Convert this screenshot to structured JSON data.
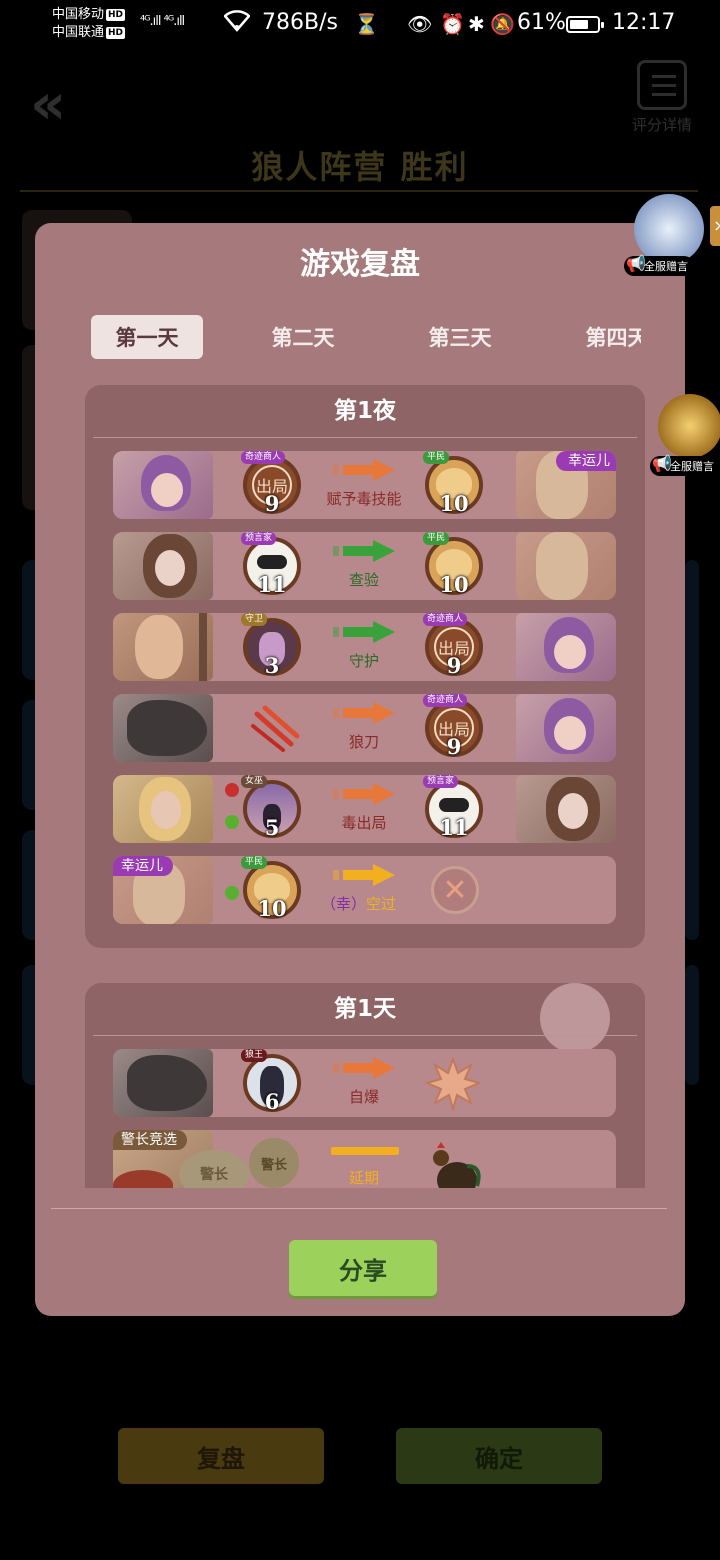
{
  "status_bar": {
    "carrier1": "中国移动",
    "carrier2": "中国联通",
    "hd": "HD",
    "signal": "⁴ᴳ.ıll ⁴ᴳ.ıll",
    "speed": "786B/s",
    "battery": "61%",
    "time": "12:17"
  },
  "background": {
    "detail_label": "评分详情",
    "result_title": "狼人阵营  胜利",
    "replay_button": "复盘",
    "confirm_button": "确定"
  },
  "side_widgets": [
    {
      "label": "全服赠言"
    },
    {
      "label": "全服赠言"
    }
  ],
  "modal": {
    "title": "游戏复盘",
    "tabs": [
      {
        "label": "第一天",
        "selected": true
      },
      {
        "label": "第二天"
      },
      {
        "label": "第三天"
      },
      {
        "label": "第四天"
      }
    ],
    "night": {
      "heading": "第1夜",
      "rows": [
        {
          "from_role": "奇迹商人",
          "from_num": "9",
          "from_badge": "出局",
          "action": "赋予毒技能",
          "arrow": "orange",
          "to_role": "平民",
          "to_num": "10",
          "tag": "幸运儿"
        },
        {
          "from_role": "预言家",
          "from_num": "11",
          "action": "查验",
          "arrow": "green",
          "to_role": "平民",
          "to_num": "10"
        },
        {
          "from_role": "守卫",
          "from_num": "3",
          "action": "守护",
          "arrow": "green",
          "to_role": "奇迹商人",
          "to_num": "9",
          "to_badge": "出局"
        },
        {
          "action": "狼刀",
          "arrow": "orange",
          "to_role": "奇迹商人",
          "to_num": "9",
          "to_badge": "出局"
        },
        {
          "from_role": "女巫",
          "from_num": "5",
          "action": "毒出局",
          "arrow": "orange",
          "to_role": "预言家",
          "to_num": "11"
        },
        {
          "left_tag": "幸运儿",
          "from_role": "平民",
          "from_num": "10",
          "action_prefix": "（幸）",
          "action": "空过",
          "arrow": "yellow"
        }
      ]
    },
    "day": {
      "heading": "第1天",
      "rows": [
        {
          "from_role": "狼王",
          "from_num": "6",
          "action": "自爆",
          "arrow": "orange"
        },
        {
          "left_tag": "警长竞选",
          "badge1": "警长",
          "badge2": "警长",
          "action": "延期",
          "arrow": "yellow"
        }
      ]
    },
    "share_button": "分享"
  }
}
